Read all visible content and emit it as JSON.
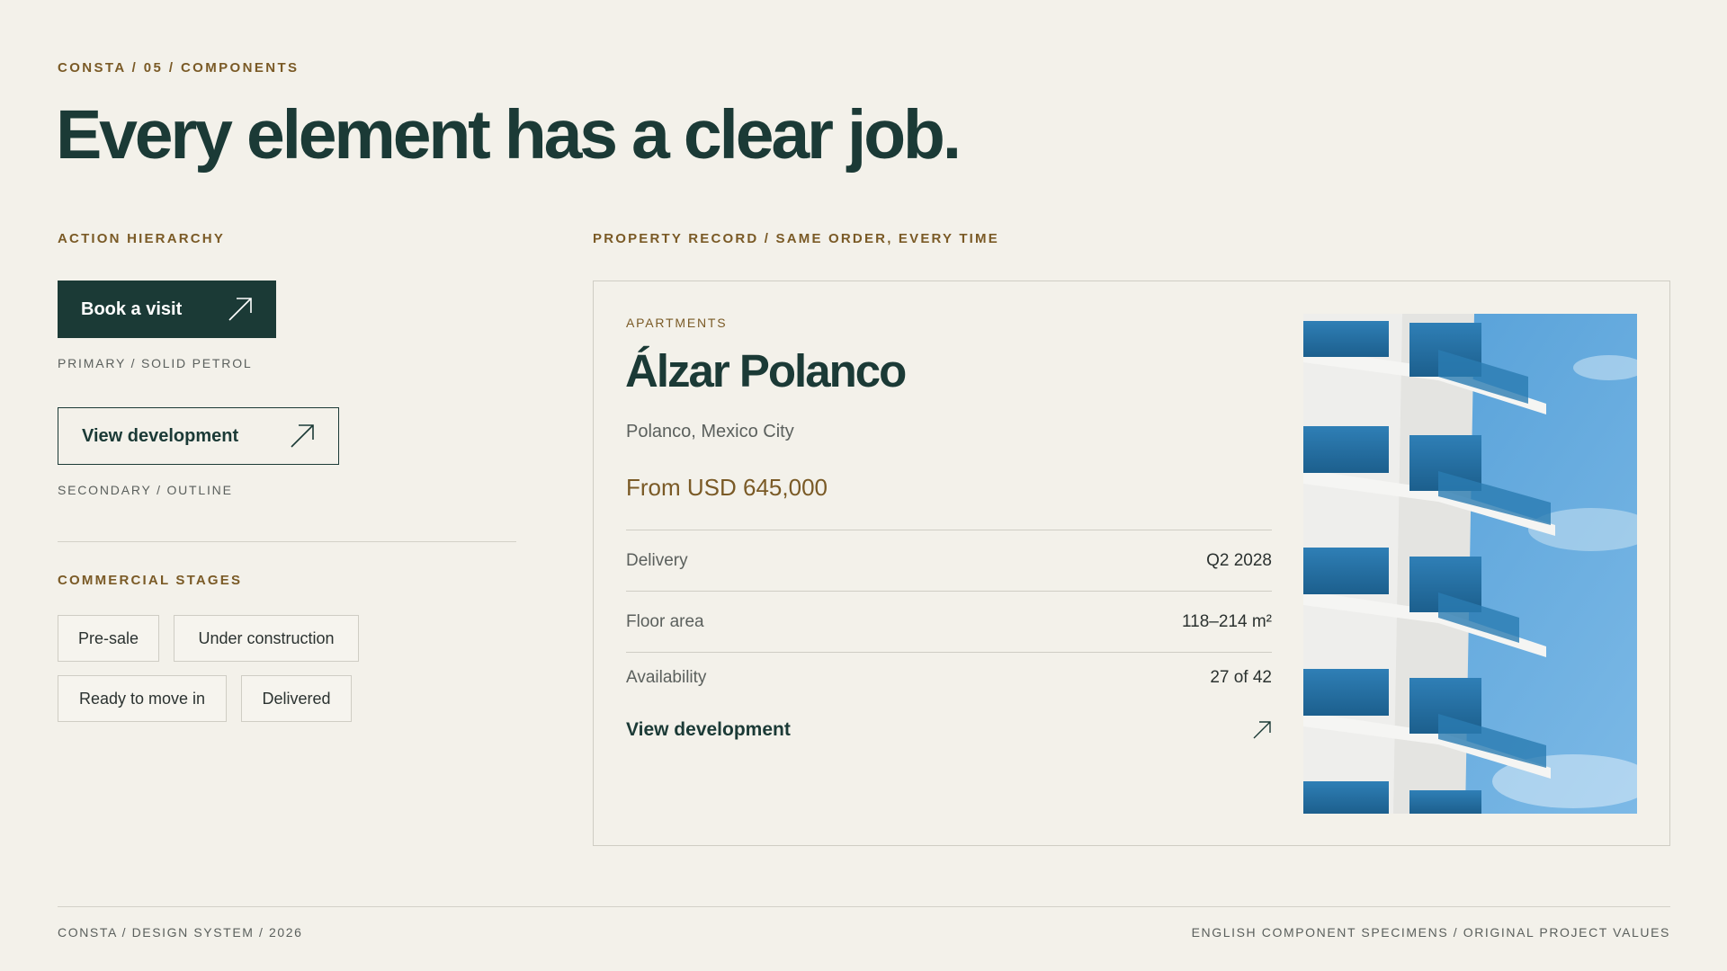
{
  "eyebrow": "CONSTA / 05 / COMPONENTS",
  "headline": "Every element has a clear job.",
  "actions": {
    "section_label": "ACTION HIERARCHY",
    "primary_label": "Book a visit",
    "primary_caption": "PRIMARY / SOLID PETROL",
    "secondary_label": "View development",
    "secondary_caption": "SECONDARY / OUTLINE"
  },
  "stages": {
    "section_label": "COMMERCIAL STAGES",
    "chips": [
      "Pre-sale",
      "Under construction",
      "Ready to move in",
      "Delivered"
    ]
  },
  "property": {
    "section_label": "PROPERTY RECORD / SAME ORDER, EVERY TIME",
    "type": "APARTMENTS",
    "name": "Álzar Polanco",
    "location": "Polanco, Mexico City",
    "price": "From USD 645,000",
    "specs": [
      {
        "label": "Delivery",
        "value": "Q2 2028"
      },
      {
        "label": "Floor area",
        "value": "118–214 m²"
      },
      {
        "label": "Availability",
        "value": "27 of 42"
      }
    ],
    "link_label": "View development",
    "image_icon": "building-facade-photo"
  },
  "footer": {
    "left": "CONSTA / DESIGN SYSTEM / 2026",
    "right": "ENGLISH COMPONENT SPECIMENS / ORIGINAL PROJECT VALUES"
  },
  "colors": {
    "background": "#f3f1ea",
    "petrol": "#1b3a36",
    "bronze": "#7a5a26",
    "muted": "#5b605d"
  }
}
